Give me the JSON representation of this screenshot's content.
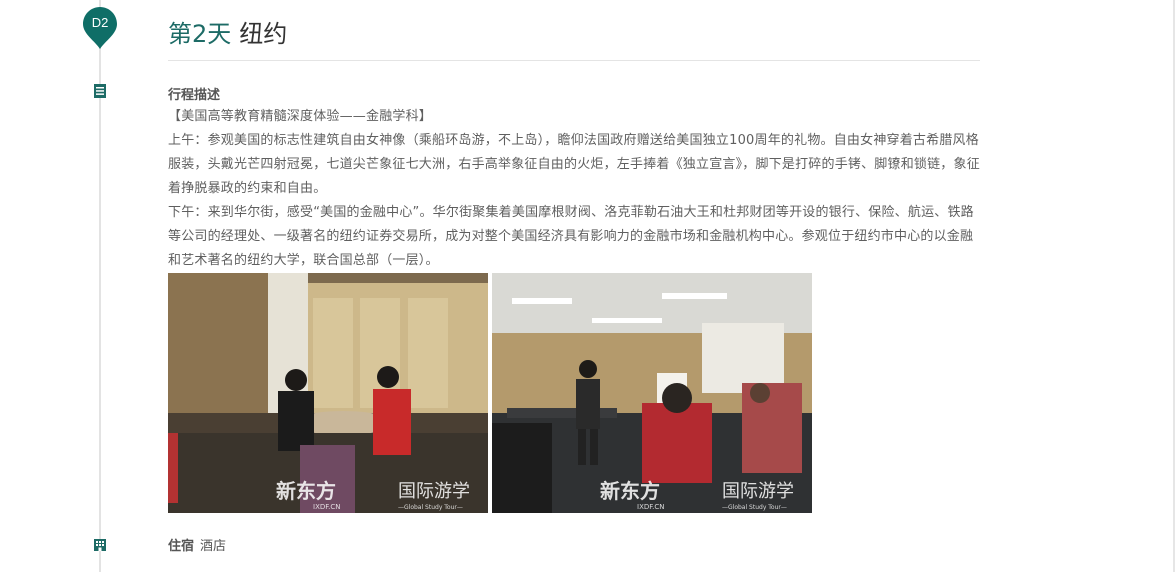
{
  "day": {
    "badge": "D2",
    "title_day": "第2天",
    "title_city": "纽约"
  },
  "itinerary": {
    "section_label": "行程描述",
    "paragraphs": [
      "【美国高等教育精髓深度体验——金融学科】",
      "上午：参观美国的标志性建筑自由女神像（乘船环岛游，不上岛），瞻仰法国政府赠送给美国独立100周年的礼物。自由女神穿着古希腊风格服装，头戴光芒四射冠冕，七道尖芒象征七大洲，右手高举象征自由的火炬，左手捧着《独立宣言》，脚下是打碎的手铐、脚镣和锁链，象征着挣脱暴政的约束和自由。",
      "下午：来到华尔街，感受“美国的金融中心”。华尔街聚集着美国摩根财阀、洛克菲勒石油大王和杜邦财团等开设的银行、保险、航运、铁路等公司的经理处、一级著名的纽约证券交易所，成为对整个美国经济具有影响力的金融市场和金融机构中心。参观位于纽约市中心的以金融和艺术著名的纽约大学，联合国总部（一层）。"
    ]
  },
  "photos": {
    "watermark_brand": "新东方",
    "watermark_text": "国际游学",
    "watermark_site": "IXDF.CN",
    "watermark_sub": "—Global Study Tour—"
  },
  "stay": {
    "label": "住宿",
    "value": "酒店"
  },
  "colors": {
    "accent": "#1d6b66",
    "badge_bg": "#0f6e67",
    "text": "#5f5f5f",
    "divider": "#e4e4e4"
  },
  "icons": [
    "map-pin-icon",
    "document-list-icon",
    "building-icon"
  ]
}
